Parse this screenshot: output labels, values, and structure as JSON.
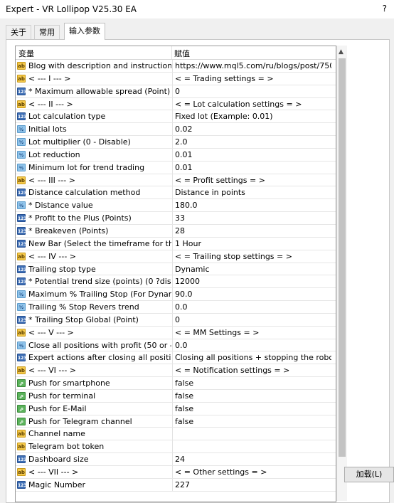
{
  "window": {
    "title": "Expert - VR Lollipop V25.30 EA",
    "help": "?"
  },
  "tabs": [
    {
      "label": "关于"
    },
    {
      "label": "常用"
    },
    {
      "label": "输入参数"
    }
  ],
  "grid": {
    "header": {
      "name": "变量",
      "value": "赋值"
    },
    "rows": [
      {
        "icon": "ab",
        "name": "Blog with description and instructions",
        "value": "https://www.mql5.com/ru/blogs/post/750..."
      },
      {
        "icon": "ab",
        "name": "< --- I --- >",
        "value": "< = Trading settings = >"
      },
      {
        "icon": "123",
        "name": "* Maximum allowable spread (Point) (...",
        "value": "0"
      },
      {
        "icon": "ab",
        "name": "< --- II --- >",
        "value": "< = Lot calculation settings = >"
      },
      {
        "icon": "123",
        "name": "Lot calculation type",
        "value": "Fixed lot (Example: 0.01)"
      },
      {
        "icon": "half",
        "name": "Initial lots",
        "value": "0.02"
      },
      {
        "icon": "half",
        "name": "Lot multiplier (0 - Disable)",
        "value": "2.0"
      },
      {
        "icon": "half",
        "name": "Lot reduction",
        "value": "0.01"
      },
      {
        "icon": "half",
        "name": "Minimum lot for trend trading",
        "value": "0.01"
      },
      {
        "icon": "ab",
        "name": "< --- III --- >",
        "value": "< = Profit settings = >"
      },
      {
        "icon": "123",
        "name": "Distance calculation method",
        "value": "Distance in points"
      },
      {
        "icon": "half",
        "name": "* Distance value",
        "value": "180.0"
      },
      {
        "icon": "123",
        "name": "* Profit to the Plus (Points)",
        "value": "33"
      },
      {
        "icon": "123",
        "name": "* Breakeven (Points)",
        "value": "28"
      },
      {
        "icon": "123",
        "name": "New Bar (Select the timeframe for the...",
        "value": "1 Hour"
      },
      {
        "icon": "ab",
        "name": "< --- IV --- >",
        "value": "< = Trailing stop settings = >"
      },
      {
        "icon": "123",
        "name": "Trailing stop type",
        "value": "Dynamic"
      },
      {
        "icon": "123",
        "name": "* Potential trend size (points) (0 ?disa...",
        "value": "12000"
      },
      {
        "icon": "half",
        "name": "Maximum % Trailing Stop (For Dynam...",
        "value": "90.0"
      },
      {
        "icon": "half",
        "name": "Trailing % Stop Revers trend",
        "value": "0.0"
      },
      {
        "icon": "123",
        "name": "* Trailing Stop Global (Point)",
        "value": "0"
      },
      {
        "icon": "ab",
        "name": "< --- V --- >",
        "value": "< = MM Settings = >"
      },
      {
        "icon": "half",
        "name": "Close all positions with profit (50 or -...",
        "value": "0.0"
      },
      {
        "icon": "123",
        "name": "Expert actions after closing all positions",
        "value": "Closing all positions + stopping the robot"
      },
      {
        "icon": "ab",
        "name": "< --- VI --- >",
        "value": "< = Notification settings = >"
      },
      {
        "icon": "bool",
        "name": "Push for smartphone",
        "value": "false"
      },
      {
        "icon": "bool",
        "name": "Push for terminal",
        "value": "false"
      },
      {
        "icon": "bool",
        "name": "Push for E-Mail",
        "value": "false"
      },
      {
        "icon": "bool",
        "name": "Push for Telegram channel",
        "value": "false"
      },
      {
        "icon": "ab",
        "name": "Channel name",
        "value": ""
      },
      {
        "icon": "ab",
        "name": "Telegram bot token",
        "value": ""
      },
      {
        "icon": "123",
        "name": "Dashboard size",
        "value": "24"
      },
      {
        "icon": "ab",
        "name": "< --- VII --- >",
        "value": "< = Other settings = >"
      },
      {
        "icon": "123",
        "name": "Magic Number",
        "value": "227"
      }
    ]
  },
  "icons": {
    "ab": {
      "glyph": "ab",
      "name": "string-param-icon"
    },
    "123": {
      "glyph": "123",
      "name": "integer-param-icon"
    },
    "half": {
      "glyph": "½",
      "name": "double-param-icon"
    },
    "bool": {
      "glyph": "⇗",
      "name": "bool-param-icon"
    }
  },
  "buttons": {
    "load": "加载(L)"
  }
}
